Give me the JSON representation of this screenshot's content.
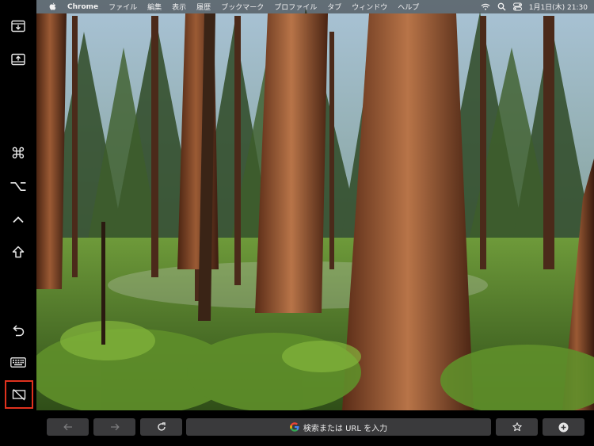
{
  "menubar": {
    "app": "Chrome",
    "items": [
      "ファイル",
      "編集",
      "表示",
      "履歴",
      "ブックマーク",
      "プロファイル",
      "タブ",
      "ウィンドウ",
      "ヘルプ"
    ],
    "datetime": "1月1日(木) 21:30"
  },
  "sidebar": {
    "buttons": [
      "import-screen",
      "export-screen",
      "command-key",
      "option-key",
      "control-key",
      "shift-key",
      "undo",
      "keyboard",
      "toggle-display"
    ],
    "command_glyph": "⌘",
    "option_glyph": "⌥",
    "control_glyph": "^",
    "highlight_color": "#e0321e"
  },
  "toolbar": {
    "back_icon": "arrow-left-icon",
    "forward_icon": "arrow-right-icon",
    "reload_icon": "reload-icon",
    "address_placeholder": "検索または URL を入力",
    "bookmark_icon": "star-icon",
    "new_tab_icon": "plus-circle-icon"
  }
}
